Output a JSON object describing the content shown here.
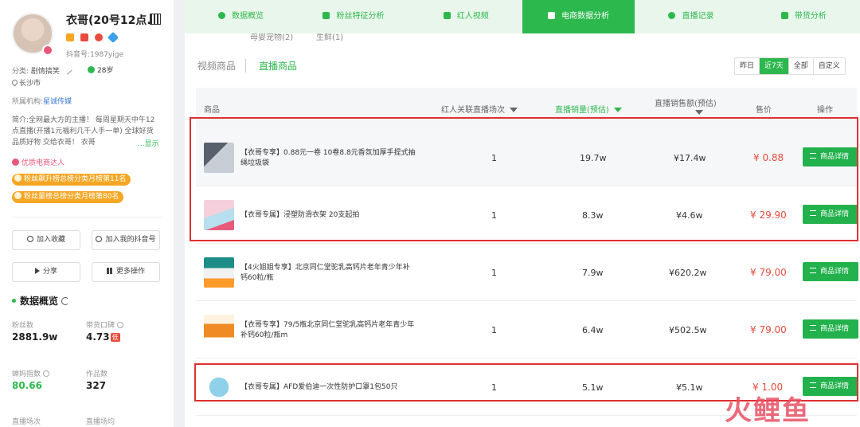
{
  "profile": {
    "name": "衣哥(20号12点...",
    "douyin_id": "抖音号:1987yige",
    "category_label": "分类:",
    "category_value": "剧情搞笑",
    "age": "28岁",
    "city": "长沙市",
    "agency_label": "所属机构:",
    "agency_value": "星诚传媒",
    "intro": "简介:全网最大方的主播！ 每周星期天中午12点直播(开播1元福利几千人手一单) 全球好货 品质好物 交给衣哥！ 衣哥",
    "intro_more": "...显示",
    "quality_tag": "优质电商达人",
    "rank_tags": [
      "粉丝飙升榜总榜分类月榜第11名",
      "粉丝量榜总榜分类月榜第80名"
    ],
    "buttons": {
      "collect": "加入收藏",
      "add_account": "加入我的抖音号",
      "share": "分享",
      "more": "更多操作"
    },
    "overview_title": "数据概览",
    "metrics": [
      {
        "label": "粉丝数",
        "value": "2881.9w"
      },
      {
        "label": "带货口碑",
        "value": "4.73",
        "tag": "低"
      },
      {
        "label": "蝉妈指数",
        "value": "80.66"
      },
      {
        "label": "作品数",
        "value": "327"
      }
    ],
    "cut_labels": [
      "直播场次",
      "直播场均"
    ]
  },
  "tabs": [
    {
      "label": "数据概览",
      "icon": "pie-chart-icon"
    },
    {
      "label": "粉丝特征分析",
      "icon": "user-card-icon"
    },
    {
      "label": "红人视频",
      "icon": "video-icon"
    },
    {
      "label": "电商数据分析",
      "icon": "shopping-bag-icon",
      "active": true
    },
    {
      "label": "直播记录",
      "icon": "clock-icon"
    },
    {
      "label": "带货分析",
      "icon": "store-icon"
    }
  ],
  "cut_categories": [
    "母婴宠物(2)",
    "生鲜(1)"
  ],
  "sub_tabs": [
    "视频商品",
    "直播商品"
  ],
  "date_range": [
    "昨日",
    "近7天",
    "全部",
    "自定义"
  ],
  "table": {
    "headers": {
      "product": "商品",
      "live_count": "红人关联直播场次",
      "live_sales": "直播销量(预估)",
      "live_revenue": "直播销售额(预估)",
      "price": "售价",
      "action": "操作"
    },
    "detail_label": "商品详情",
    "rows": [
      {
        "name": "【衣哥专享】0.88元一卷 10卷8.8元香氛加厚手提式抽绳垃圾袋",
        "count": "1",
        "sales": "19.7w",
        "revenue": "¥17.4w",
        "price": "¥ 0.88"
      },
      {
        "name": "【衣哥专属】浸塑防滑衣架 20支起拍",
        "count": "1",
        "sales": "8.3w",
        "revenue": "¥4.6w",
        "price": "¥ 29.90"
      },
      {
        "name": "【4火姐姐专享】北京同仁堂驼乳高钙片老年青少年补钙60粒/瓶",
        "count": "1",
        "sales": "7.9w",
        "revenue": "¥620.2w",
        "price": "¥ 79.00"
      },
      {
        "name": "【衣哥专享】79/5瓶北京同仁堂驼乳高钙片老年青少年补钙60粒/瓶m",
        "count": "1",
        "sales": "6.4w",
        "revenue": "¥502.5w",
        "price": "¥ 79.00"
      },
      {
        "name": "【衣哥专属】AFD爱伯迪一次性防护口罩1包50只",
        "count": "1",
        "sales": "5.1w",
        "revenue": "¥5.1w",
        "price": "¥ 1.00"
      }
    ]
  },
  "watermark": "火鲤鱼",
  "colors": {
    "accent": "#2db84d",
    "price": "#e74c3c",
    "highlight": "#e03030"
  }
}
